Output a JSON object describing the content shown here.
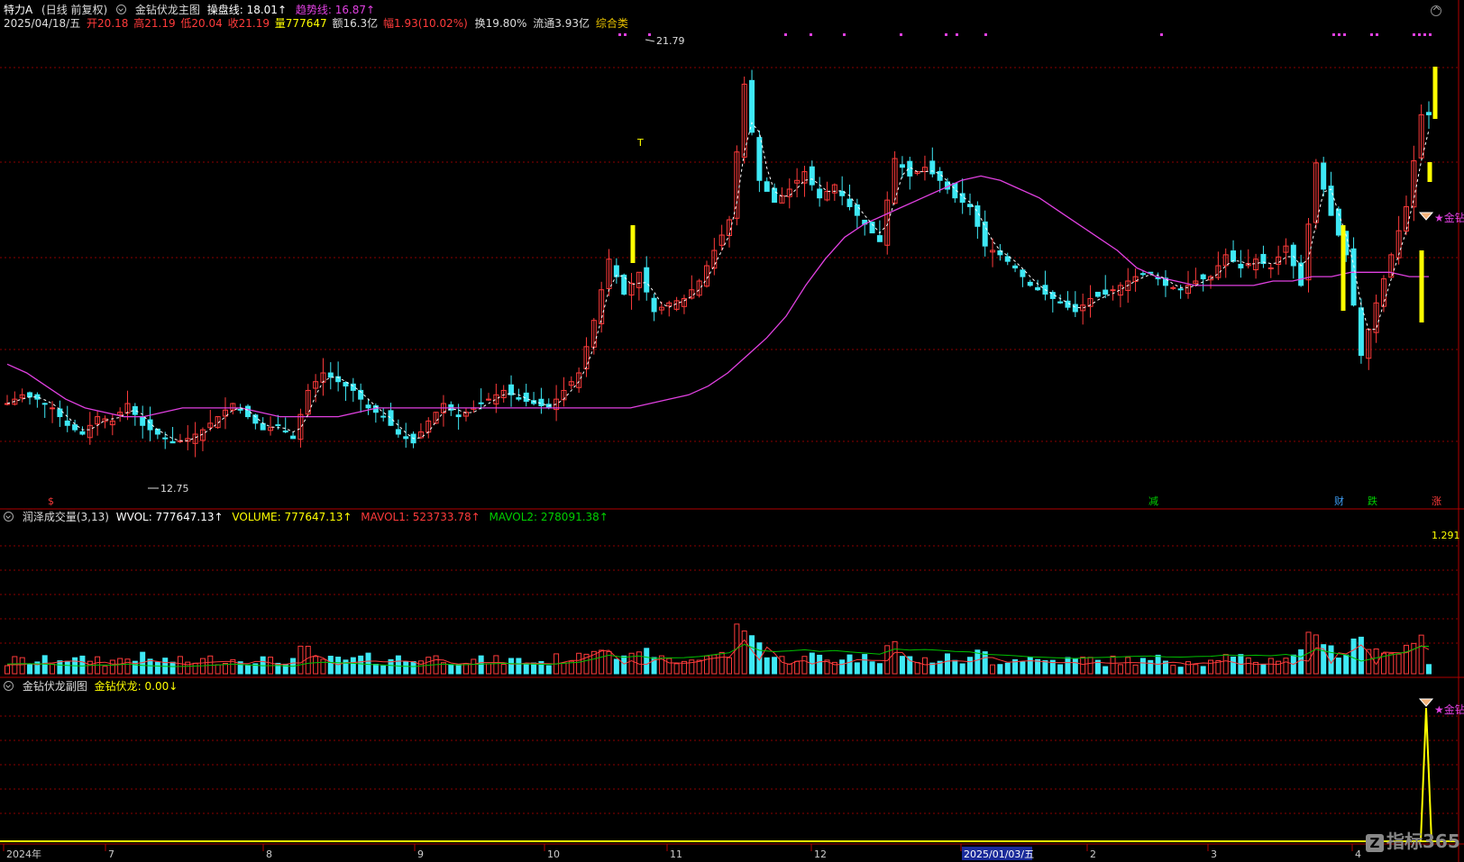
{
  "header": {
    "stock_name": "特力A",
    "period": "(日线 前复权)",
    "indicator_main": "金钻伏龙主图",
    "line1_label": "操盘线: 18.01↑",
    "line2_label": "趋势线: 16.87↑",
    "date": "2025/04/18/五",
    "open": "开20.18",
    "high": "高21.19",
    "low": "低20.04",
    "close": "收21.19",
    "volume": "量777647",
    "amount": "额16.3亿",
    "change": "幅1.93(10.02%)",
    "turnover": "换19.80%",
    "float": "流通3.93亿",
    "category": "综合类"
  },
  "volume_panel": {
    "title": "润泽成交量(3,13)",
    "wvol": "WVOL: 777647.13↑",
    "volume": "VOLUME: 777647.13↑",
    "mavol1": "MAVOL1: 523733.78↑",
    "mavol2": "MAVOL2: 278091.38↑",
    "scale_label": "1.291"
  },
  "sub_panel": {
    "title": "金钻伏龙副图",
    "value": "金钻伏龙: 0.00↓",
    "signal_label": "金钻"
  },
  "main_panel": {
    "high_label": "21.79",
    "low_label": "12.75",
    "t_marker": "T",
    "signal_label": "金钻",
    "bottom_markers": [
      "$",
      "减",
      "财",
      "跌",
      "涨"
    ]
  },
  "time_axis": {
    "labels": [
      "2024年",
      "7",
      "8",
      "9",
      "10",
      "11",
      "12",
      "2025/01/03/五",
      "2",
      "3",
      "4"
    ]
  },
  "watermark": "指标365",
  "colors": {
    "up": "#ff3b3b",
    "down": "#3ee8f5",
    "ma_magenta": "#e040e0",
    "signal_yellow": "#ffff00",
    "grid_red": "#8b0000",
    "mavol_green": "#00c000"
  },
  "chart_data": {
    "type": "candlestick",
    "price_range": [
      11.8,
      22.3
    ],
    "close_series_approx": [
      13.9,
      14.1,
      14.0,
      13.8,
      13.4,
      13.2,
      13.6,
      13.5,
      13.9,
      13.4,
      13.2,
      13.0,
      13.1,
      13.3,
      13.6,
      13.9,
      13.6,
      13.3,
      13.4,
      13.1,
      14.2,
      14.6,
      14.4,
      14.2,
      13.8,
      13.6,
      13.2,
      13.0,
      13.5,
      13.9,
      13.6,
      13.8,
      14.0,
      14.2,
      14.0,
      13.9,
      13.8,
      14.2,
      14.6,
      15.8,
      17.2,
      16.4,
      16.9,
      16.0,
      16.2,
      16.3,
      16.7,
      17.4,
      18.1,
      21.2,
      19.0,
      18.5,
      18.8,
      19.2,
      18.6,
      18.9,
      18.4,
      18.0,
      17.6,
      19.5,
      19.1,
      19.3,
      19.0,
      18.6,
      18.4,
      17.5,
      17.3,
      17.0,
      16.6,
      16.4,
      16.2,
      16.0,
      16.3,
      16.4,
      16.6,
      16.8,
      16.9,
      16.6,
      16.5,
      16.7,
      16.8,
      17.3,
      17.0,
      17.2,
      17.0,
      17.5,
      16.6,
      19.4,
      18.2,
      17.3,
      15.0,
      16.2,
      17.3,
      18.4,
      20.5
    ],
    "ma_series_approx": [
      14.8,
      14.6,
      14.3,
      14.0,
      13.8,
      13.7,
      13.6,
      13.6,
      13.7,
      13.8,
      13.8,
      13.8,
      13.8,
      13.7,
      13.6,
      13.6,
      13.6,
      13.6,
      13.7,
      13.8,
      13.8,
      13.8,
      13.8,
      13.8,
      13.8,
      13.8,
      13.8,
      13.8,
      13.8,
      13.8,
      13.8,
      13.8,
      13.8,
      13.9,
      14.0,
      14.1,
      14.3,
      14.6,
      15.0,
      15.4,
      15.9,
      16.6,
      17.2,
      17.7,
      18.0,
      18.2,
      18.4,
      18.6,
      18.8,
      19.0,
      19.1,
      19.0,
      18.8,
      18.6,
      18.3,
      18.0,
      17.7,
      17.4,
      17.0,
      16.8,
      16.7,
      16.6,
      16.6,
      16.6,
      16.6,
      16.7,
      16.7,
      16.8,
      16.8,
      16.9,
      16.9,
      16.9,
      16.8,
      16.8
    ],
    "volume_peak_label": "1.291"
  }
}
